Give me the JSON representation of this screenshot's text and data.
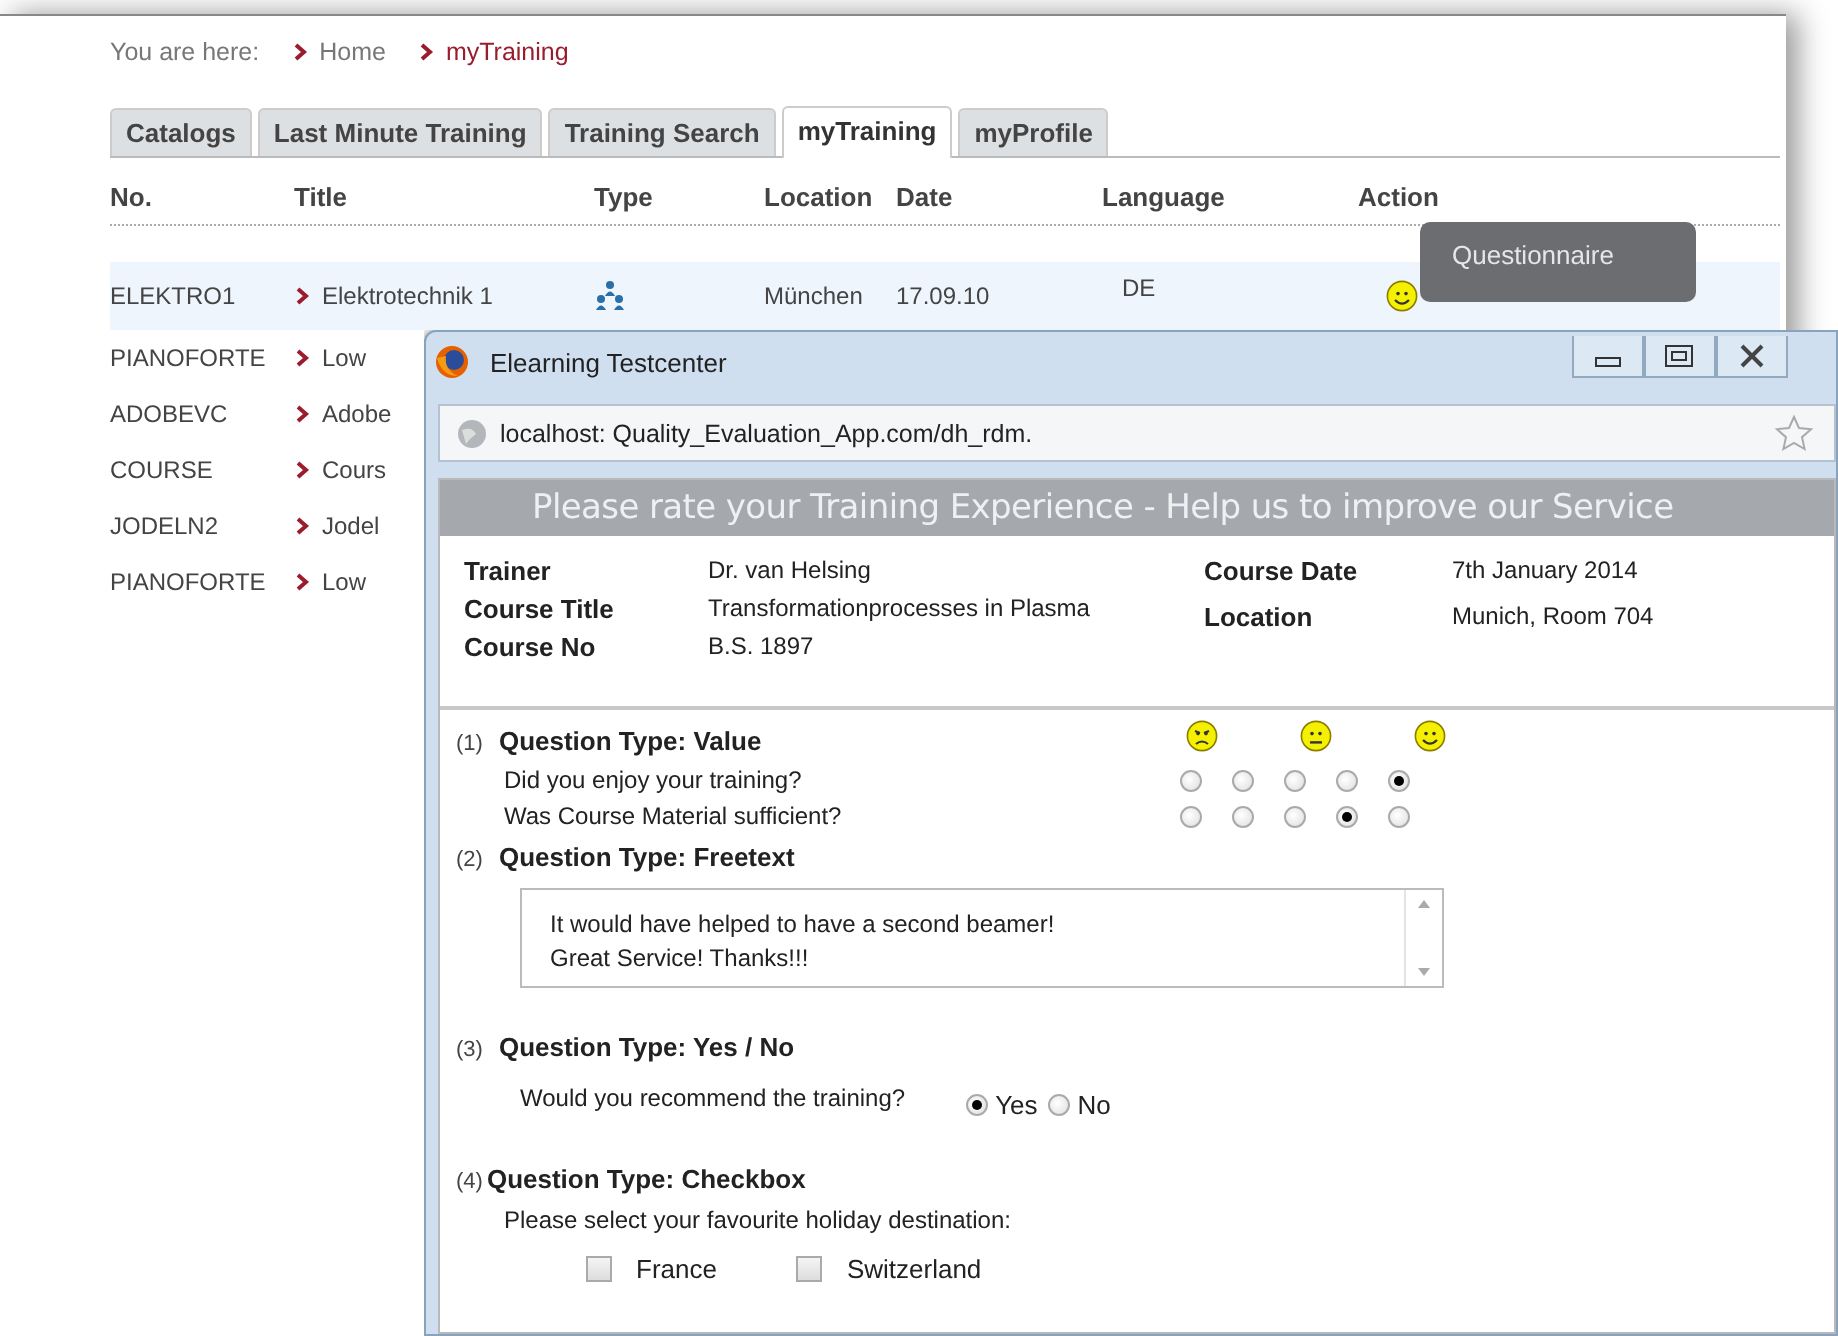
{
  "breadcrumb": {
    "label": "You are here:",
    "items": [
      {
        "text": "Home",
        "current": false
      },
      {
        "text": "myTraining",
        "current": true
      }
    ]
  },
  "tabs": [
    {
      "label": "Catalogs",
      "selected": false
    },
    {
      "label": "Last Minute Training",
      "selected": false
    },
    {
      "label": "Training Search",
      "selected": false
    },
    {
      "label": "myTraining",
      "selected": true
    },
    {
      "label": "myProfile",
      "selected": false
    }
  ],
  "table": {
    "columns": [
      "No.",
      "Title",
      "Type",
      "Location",
      "Date",
      "Language",
      "Action"
    ],
    "rows": [
      {
        "no": "ELEKTRO1",
        "title": "Elektrotechnik 1",
        "location": "München",
        "date": "17.09.10",
        "language": "DE",
        "highlighted": true
      },
      {
        "no": "PIANOFORTE",
        "title": "Low",
        "highlighted": false
      },
      {
        "no": "ADOBEVC",
        "title": "Adobe",
        "highlighted": false
      },
      {
        "no": "COURSE",
        "title": "Cours",
        "highlighted": false
      },
      {
        "no": "JODELN2",
        "title": "Jodel",
        "highlighted": false
      },
      {
        "no": "PIANOFORTE",
        "title": "Low",
        "highlighted": false
      }
    ]
  },
  "tooltip": {
    "text": "Questionnaire"
  },
  "popup": {
    "title": "Elearning Testcenter",
    "address": "localhost: Quality_Evaluation_App.com/dh_rdm.",
    "banner": "Please rate your Training Experience - Help us to improve our Service",
    "details_left": [
      {
        "label": "Trainer",
        "value": "Dr. van Helsing"
      },
      {
        "label": "Course Title",
        "value": "Transformationprocesses in Plasma"
      },
      {
        "label": "Course No",
        "value": "B.S. 1897"
      }
    ],
    "details_right": [
      {
        "label": "Course Date",
        "value": "7th January 2014"
      },
      {
        "label": "Location",
        "value": "Munich, Room 704"
      }
    ],
    "questions": [
      {
        "kind": "value",
        "number": "(1)",
        "title": "Question Type: Value",
        "items": [
          {
            "text": "Did you enjoy your training?",
            "choices": [
              {
                "selected": false
              },
              {
                "selected": false
              },
              {
                "selected": false
              },
              {
                "selected": false
              },
              {
                "selected": true
              }
            ]
          },
          {
            "text": "Was Course Material sufficient?",
            "choices": [
              {
                "selected": false
              },
              {
                "selected": false
              },
              {
                "selected": false
              },
              {
                "selected": true
              },
              {
                "selected": false
              }
            ]
          }
        ]
      },
      {
        "kind": "freetext",
        "number": "(2)",
        "title": "Question Type: Freetext",
        "value": "It would have helped to have a second beamer!\nGreat Service! Thanks!!!"
      },
      {
        "kind": "yesno",
        "number": "(3)",
        "title": "Question Type: Yes / No",
        "prompt": "Would you recommend the training?",
        "options": [
          {
            "label": "Yes",
            "selected": true
          },
          {
            "label": "No",
            "selected": false
          }
        ]
      },
      {
        "kind": "checkbox",
        "number": "(4)",
        "title": "Question Type: Checkbox",
        "prompt": "Please select your favourite holiday destination:",
        "options": [
          {
            "label": "France",
            "checked": false
          },
          {
            "label": "Switzerland",
            "checked": false
          }
        ]
      }
    ]
  }
}
